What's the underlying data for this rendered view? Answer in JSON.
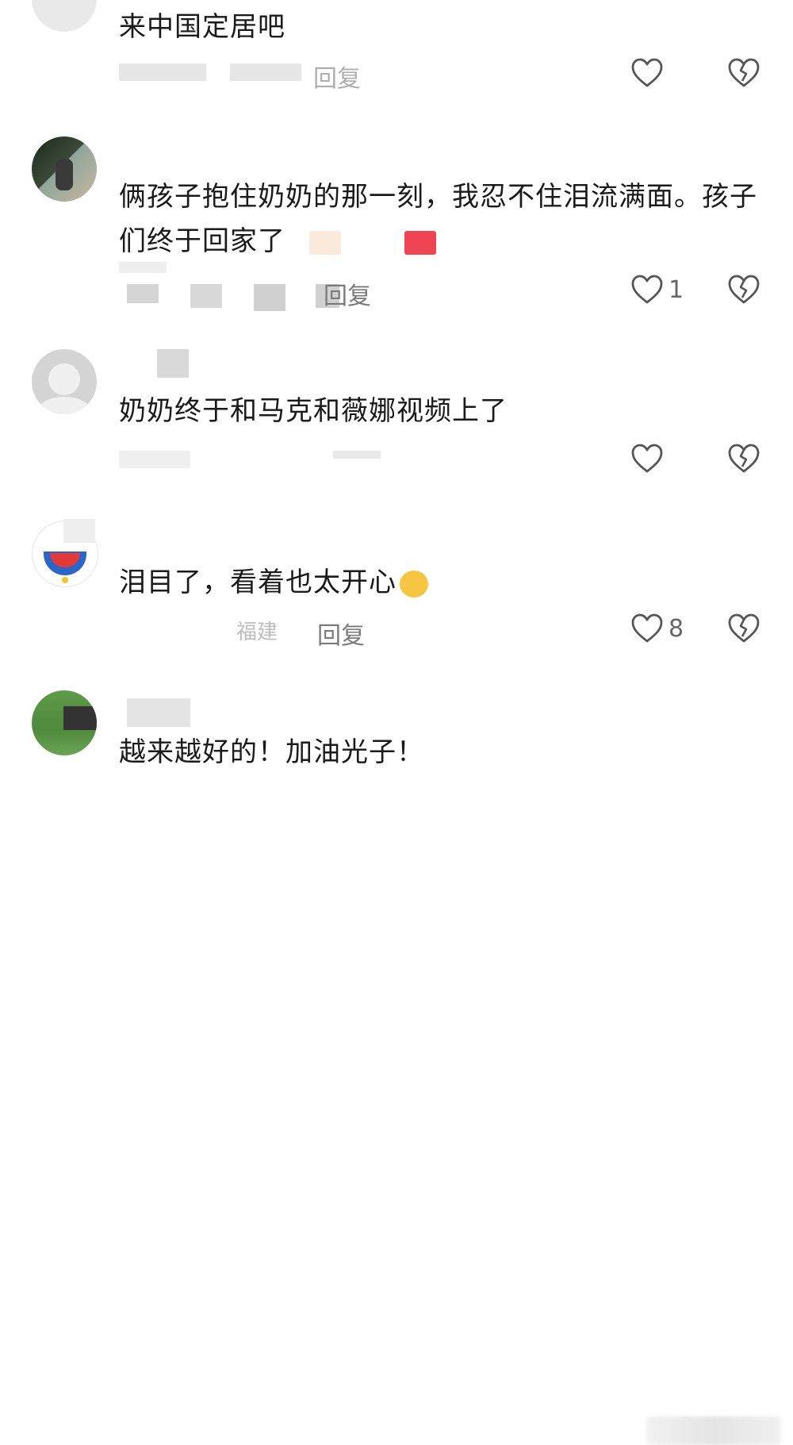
{
  "comments": [
    {
      "text": "来中国定居吧",
      "time": "",
      "location": "",
      "reply": "回复",
      "likes": ""
    },
    {
      "username": "",
      "text": "俩孩子抱住奶奶的那一刻，我忍不住泪流满面。孩子们终于回家了",
      "reply": "回复",
      "likes": "1"
    },
    {
      "username": "",
      "text": "奶奶终于和马克和薇娜视频上了",
      "reply": "",
      "likes": ""
    },
    {
      "username": "",
      "text": "泪目了，看着也太开心",
      "location": "福建",
      "reply": "回复",
      "likes": "8"
    },
    {
      "username": "",
      "text": "越来越好的！加油光子！"
    }
  ],
  "icons": {
    "like": "heart-outline-icon",
    "dislike": "broken-heart-icon"
  },
  "colors": {
    "text": "#1a1a1a",
    "meta": "#8a8a8a",
    "icon": "#555555"
  }
}
